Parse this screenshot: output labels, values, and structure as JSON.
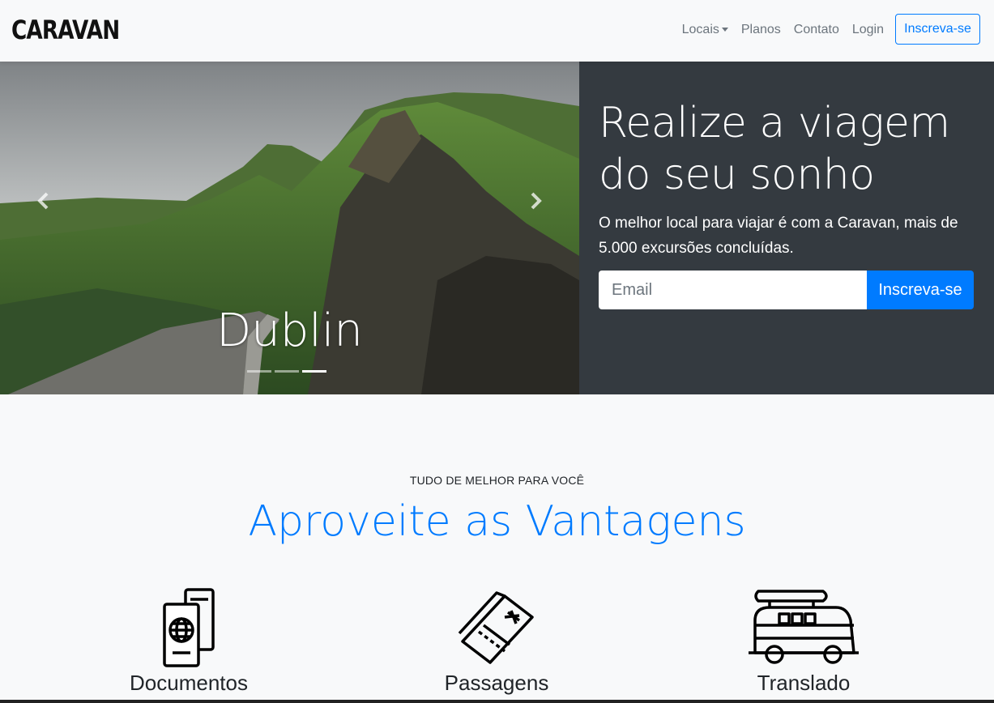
{
  "navbar": {
    "brand": "CARAVAN",
    "links": [
      "Locais",
      "Planos",
      "Contato",
      "Login"
    ],
    "cta": "Inscreva-se"
  },
  "carousel": {
    "caption": "Dublin",
    "indicator_count": 3,
    "active_indicator": 3,
    "prev_icon": "chevron-left-icon",
    "next_icon": "chevron-right-icon"
  },
  "hero": {
    "title": "Realize a viagem do seu sonho",
    "subtitle": "O melhor local para viajar é com a Caravan, mais de 5.000 excursões concluídas.",
    "email_placeholder": "Email",
    "cta": "Inscreva-se"
  },
  "features": {
    "eyebrow": "TUDO DE MELHOR PARA VOCÊ",
    "title": "Aproveite as Vantagens",
    "items": [
      {
        "label": "Documentos",
        "icon": "passport-icon"
      },
      {
        "label": "Passagens",
        "icon": "ticket-icon"
      },
      {
        "label": "Translado",
        "icon": "van-icon"
      }
    ]
  },
  "colors": {
    "accent": "#007bff",
    "dark_panel": "#343a40",
    "background": "#f8f9fa"
  }
}
